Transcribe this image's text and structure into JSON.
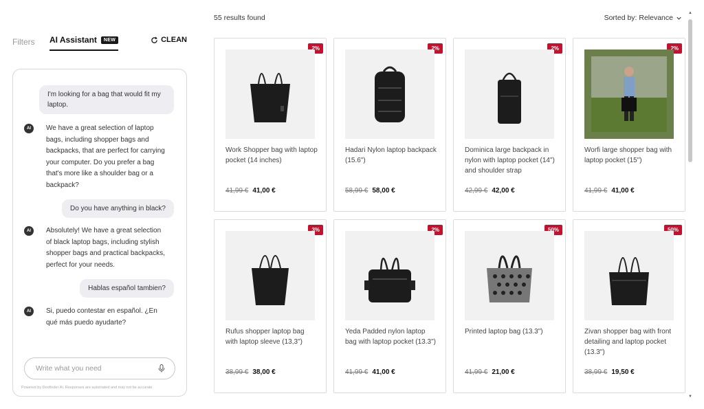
{
  "sidebar": {
    "tab_filters": "Filters",
    "tab_ai": "AI Assistant",
    "new_badge": "NEW",
    "clean_label": "CLEAN"
  },
  "chat": {
    "messages": [
      {
        "role": "user",
        "text": "I'm looking for a bag that would fit my laptop."
      },
      {
        "role": "ai",
        "avatar": "AI",
        "text": "We have a great selection of laptop bags, including shopper bags and backpacks, that are perfect for carrying your computer. Do you prefer a bag that's more like a shoulder bag or a backpack?"
      },
      {
        "role": "user",
        "text": "Do you have anything in black?"
      },
      {
        "role": "ai",
        "avatar": "AI",
        "text": "Absolutely! We have a great selection of black laptop bags, including stylish shopper bags and practical backpacks, perfect for your needs."
      },
      {
        "role": "user",
        "text": "Hablas español tambien?"
      },
      {
        "role": "ai",
        "avatar": "AI",
        "text": "Si, puedo contestar en español. ¿En qué más puedo ayudarte?"
      }
    ],
    "input_placeholder": "Write what you need",
    "powered_by": "Powered by Doofinder AI. Responses are automated and may not be accurate."
  },
  "results": {
    "count_text": "55 results found",
    "sort_label": "Sorted by: Relevance"
  },
  "products": [
    {
      "discount": "2%",
      "title": "Work Shopper bag with laptop pocket (14 inches)",
      "old_price": "41,99 €",
      "price": "41,00 €",
      "image": "tote-bag"
    },
    {
      "discount": "2%",
      "title": "Hadari Nylon laptop backpack (15.6\")",
      "old_price": "58,99 €",
      "price": "58,00 €",
      "image": "backpack"
    },
    {
      "discount": "2%",
      "title": "Dominica large backpack in nylon with laptop pocket (14\") and shoulder strap",
      "old_price": "42,99 €",
      "price": "42,00 €",
      "image": "tall-backpack"
    },
    {
      "discount": "2%",
      "title": "Worfi large shopper bag with laptop pocket (15\")",
      "old_price": "41,99 €",
      "price": "41,00 €",
      "image": "model-photo"
    },
    {
      "discount": "3%",
      "title": "Rufus shopper laptop bag with laptop sleeve (13,3\")",
      "old_price": "38,99 €",
      "price": "38,00 €",
      "image": "tote-bag"
    },
    {
      "discount": "2%",
      "title": "Yeda Padded nylon laptop bag with laptop pocket (13.3\")",
      "old_price": "41,99 €",
      "price": "41,00 €",
      "image": "padded-bag"
    },
    {
      "discount": "50%",
      "title": "Printed laptop bag (13.3\")",
      "old_price": "41,99 €",
      "price": "21,00 €",
      "image": "printed-bag"
    },
    {
      "discount": "50%",
      "title": "Zivan shopper bag with front detailing and laptop pocket (13.3\")",
      "old_price": "38,99 €",
      "price": "19,50 €",
      "image": "tote-bag"
    }
  ],
  "colors": {
    "discount_badge": "#c8102e",
    "user_bubble": "#eeeef2",
    "image_bg": "#f1f1f1"
  }
}
